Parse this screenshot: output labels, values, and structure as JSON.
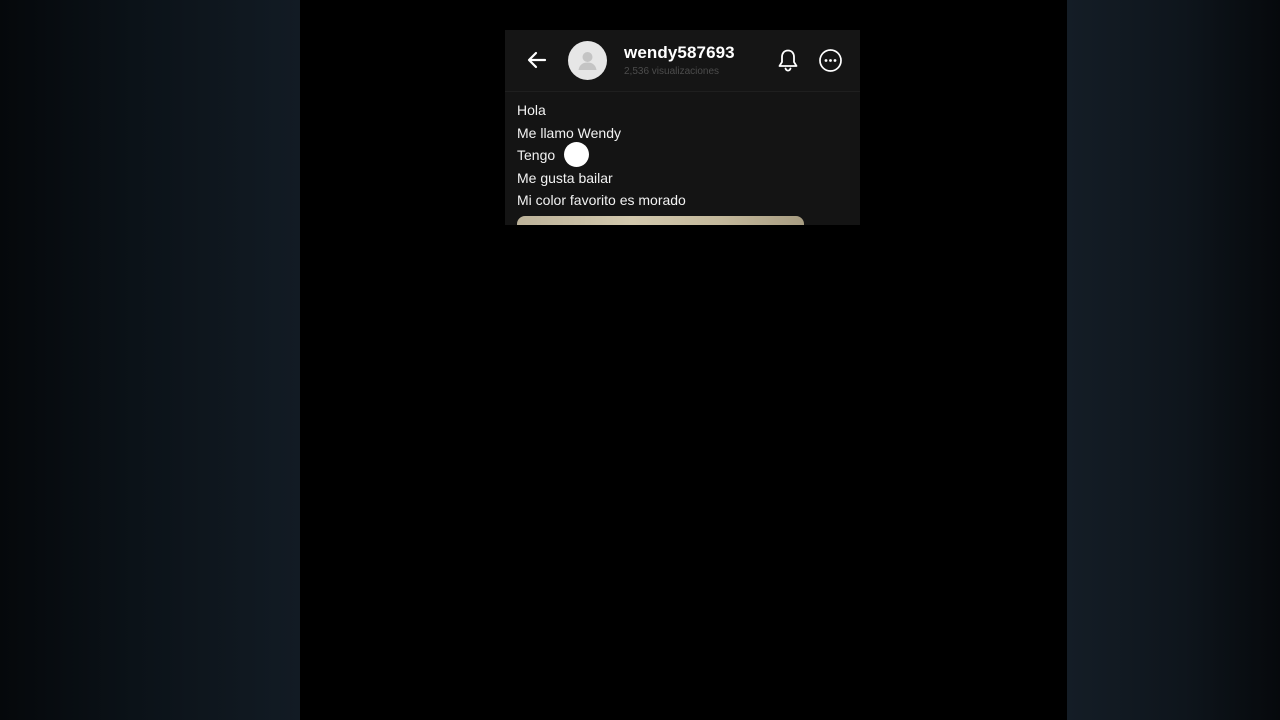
{
  "profile": {
    "username": "wendy587693",
    "views": "2,536 visualizaciones",
    "avatar_icon": "default-user-icon"
  },
  "header": {
    "back_icon": "arrow-left-icon",
    "bell_icon": "bell-icon",
    "more_icon": "more-options-icon"
  },
  "message": {
    "lines": [
      "Hola",
      "Me llamo Wendy",
      "Tengo",
      "Me gusta bailar",
      "Mi color favorito es morado"
    ]
  },
  "colors": {
    "background": "#000000",
    "panel": "#141414",
    "text": "#f2f2f2",
    "muted": "#4c4c4c"
  }
}
